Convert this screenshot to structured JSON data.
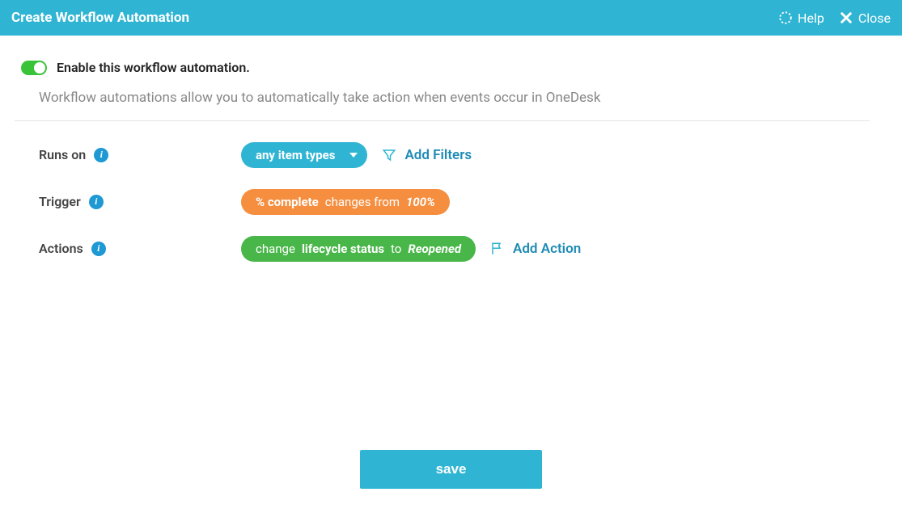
{
  "header": {
    "title": "Create Workflow Automation",
    "help_label": "Help",
    "close_label": "Close"
  },
  "enable": {
    "label": "Enable this workflow automation.",
    "enabled": true
  },
  "description": "Workflow automations allow you to automatically take action when events occur in OneDesk",
  "labels": {
    "runs_on": "Runs on",
    "trigger": "Trigger",
    "actions": "Actions",
    "add_filters": "Add Filters",
    "add_action": "Add Action"
  },
  "runs_on": {
    "value": "any item types"
  },
  "trigger": {
    "field": "% complete",
    "operator": "changes from",
    "value": "100%"
  },
  "action": {
    "verb": "change",
    "field": "lifecycle status",
    "operator": "to",
    "value": "Reopened"
  },
  "footer": {
    "save": "save"
  }
}
